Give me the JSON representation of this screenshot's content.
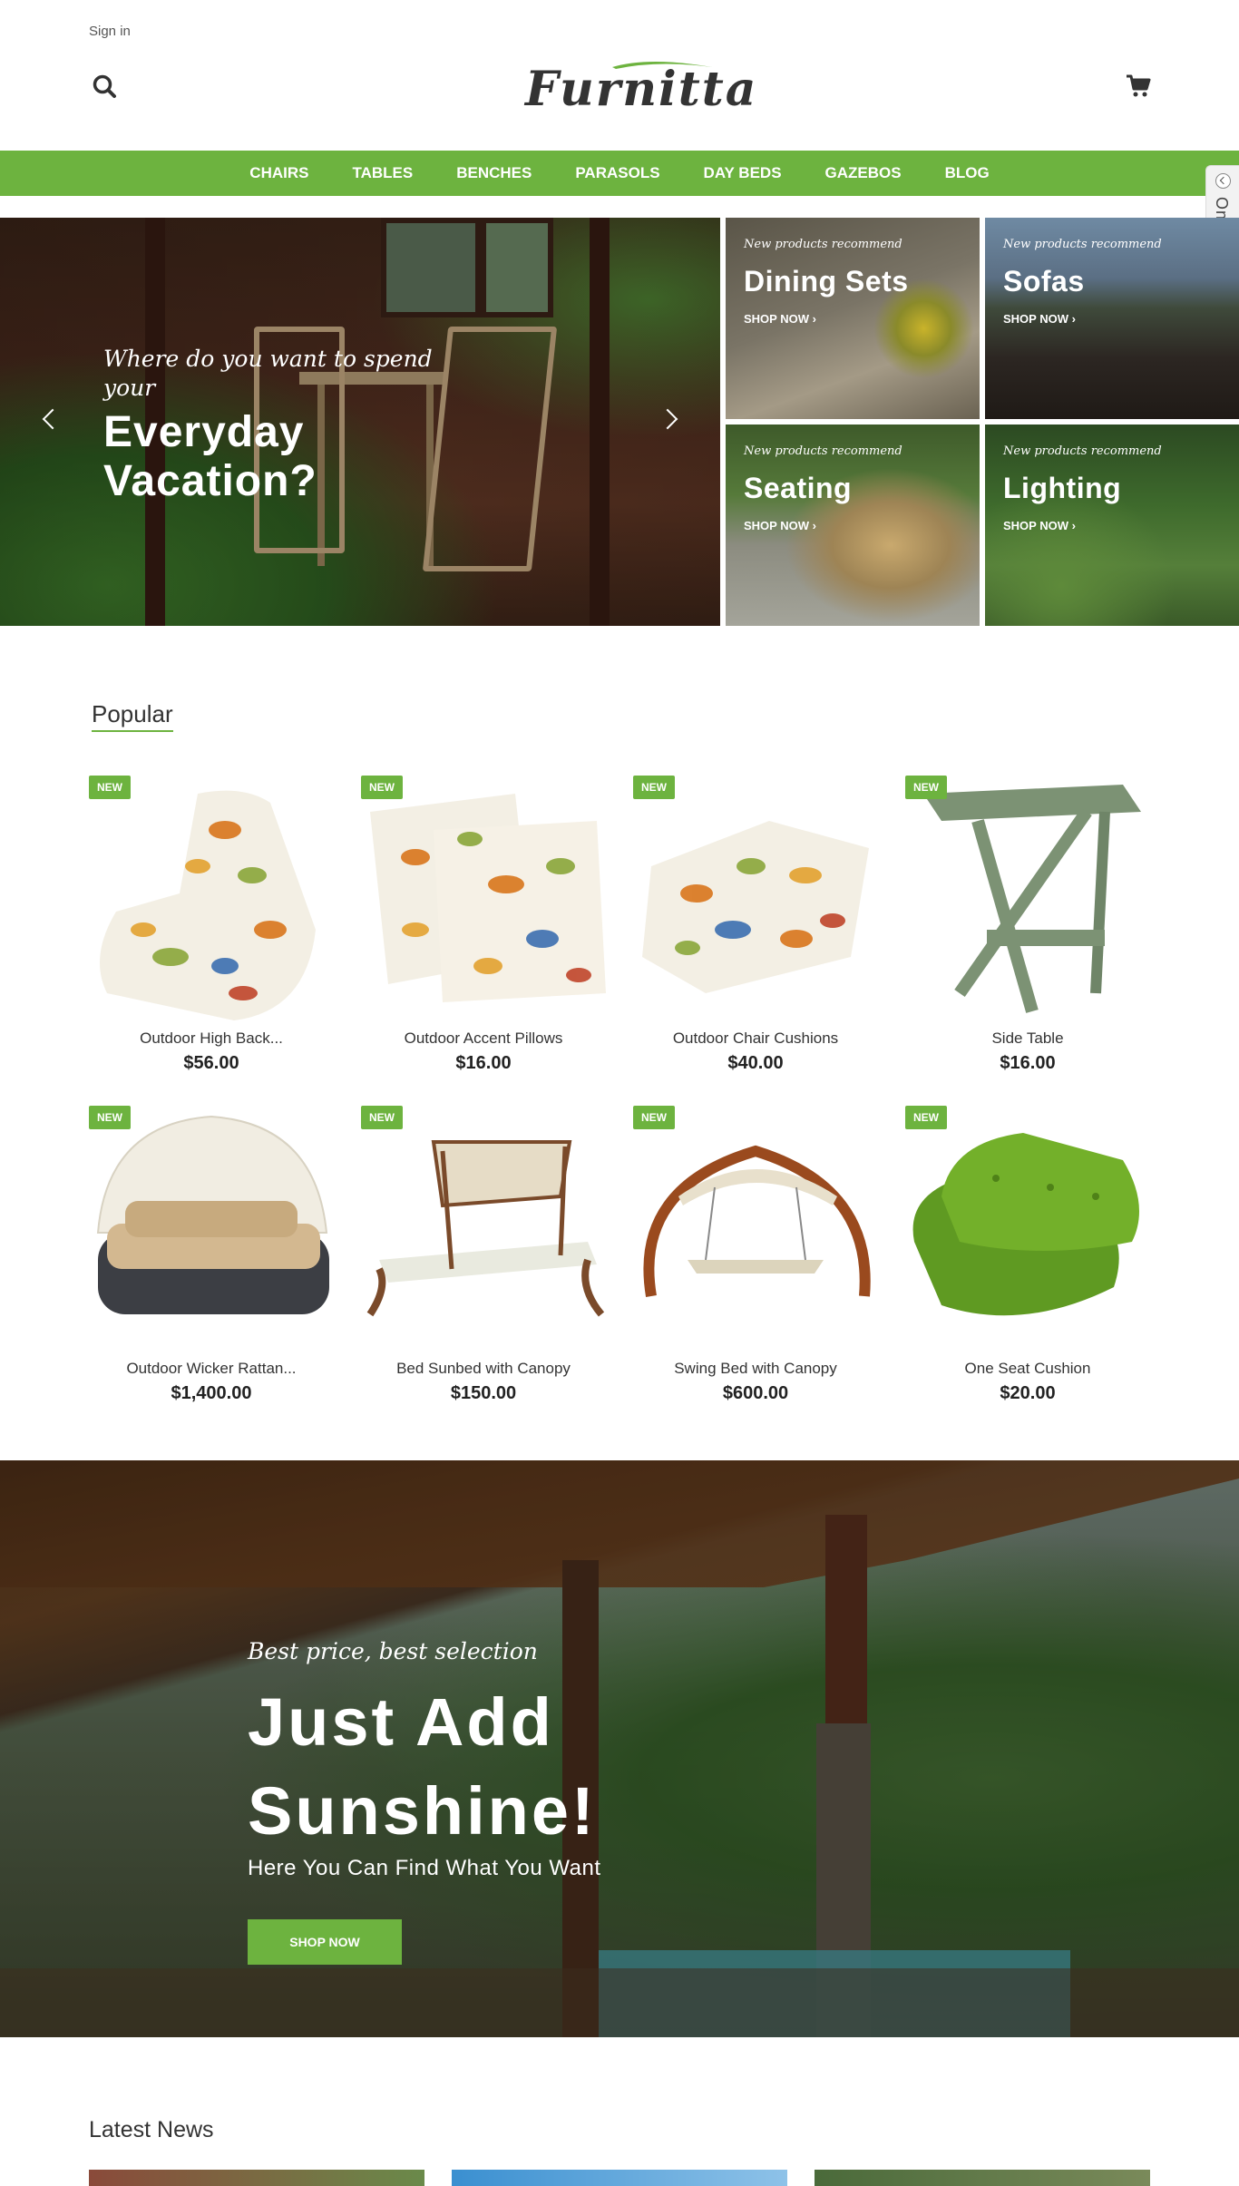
{
  "header": {
    "sign_in": "Sign in",
    "logo_text": "Furnitta",
    "search_icon": "search-icon",
    "cart_icon": "cart-icon"
  },
  "nav": {
    "items": [
      "CHAIRS",
      "TABLES",
      "BENCHES",
      "PARASOLS",
      "DAY BEDS",
      "GAZEBOS",
      "BLOG"
    ]
  },
  "side_tab": {
    "label": "Online Service"
  },
  "hero": {
    "subtitle": "Where do you want to spend your",
    "title_line1": "Everyday",
    "title_line2": "Vacation?"
  },
  "categories": [
    {
      "recommend": "New products recommend",
      "name": "Dining Sets",
      "cta": "SHOP NOW"
    },
    {
      "recommend": "New products recommend",
      "name": "Sofas",
      "cta": "SHOP NOW"
    },
    {
      "recommend": "New products recommend",
      "name": "Seating",
      "cta": "SHOP NOW"
    },
    {
      "recommend": "New products recommend",
      "name": "Lighting",
      "cta": "SHOP NOW"
    }
  ],
  "popular": {
    "title": "Popular",
    "products": [
      {
        "badge": "NEW",
        "title": "Outdoor High Back...",
        "price": "$56.00"
      },
      {
        "badge": "NEW",
        "title": "Outdoor Accent Pillows",
        "price": "$16.00"
      },
      {
        "badge": "NEW",
        "title": "Outdoor Chair Cushions",
        "price": "$40.00"
      },
      {
        "badge": "NEW",
        "title": "Side Table",
        "price": "$16.00"
      },
      {
        "badge": "NEW",
        "title": "Outdoor Wicker Rattan...",
        "price": "$1,400.00"
      },
      {
        "badge": "NEW",
        "title": "Bed Sunbed with Canopy",
        "price": "$150.00"
      },
      {
        "badge": "NEW",
        "title": "Swing Bed with Canopy",
        "price": "$600.00"
      },
      {
        "badge": "NEW",
        "title": "One Seat Cushion",
        "price": "$20.00"
      }
    ]
  },
  "promo": {
    "subtitle": "Best price, best selection",
    "title_line1": "Just Add",
    "title_line2": "Sunshine!",
    "tagline": "Here You Can Find What You Want",
    "cta": "SHOP NOW"
  },
  "news": {
    "title": "Latest News"
  },
  "colors": {
    "accent": "#6db33f"
  }
}
